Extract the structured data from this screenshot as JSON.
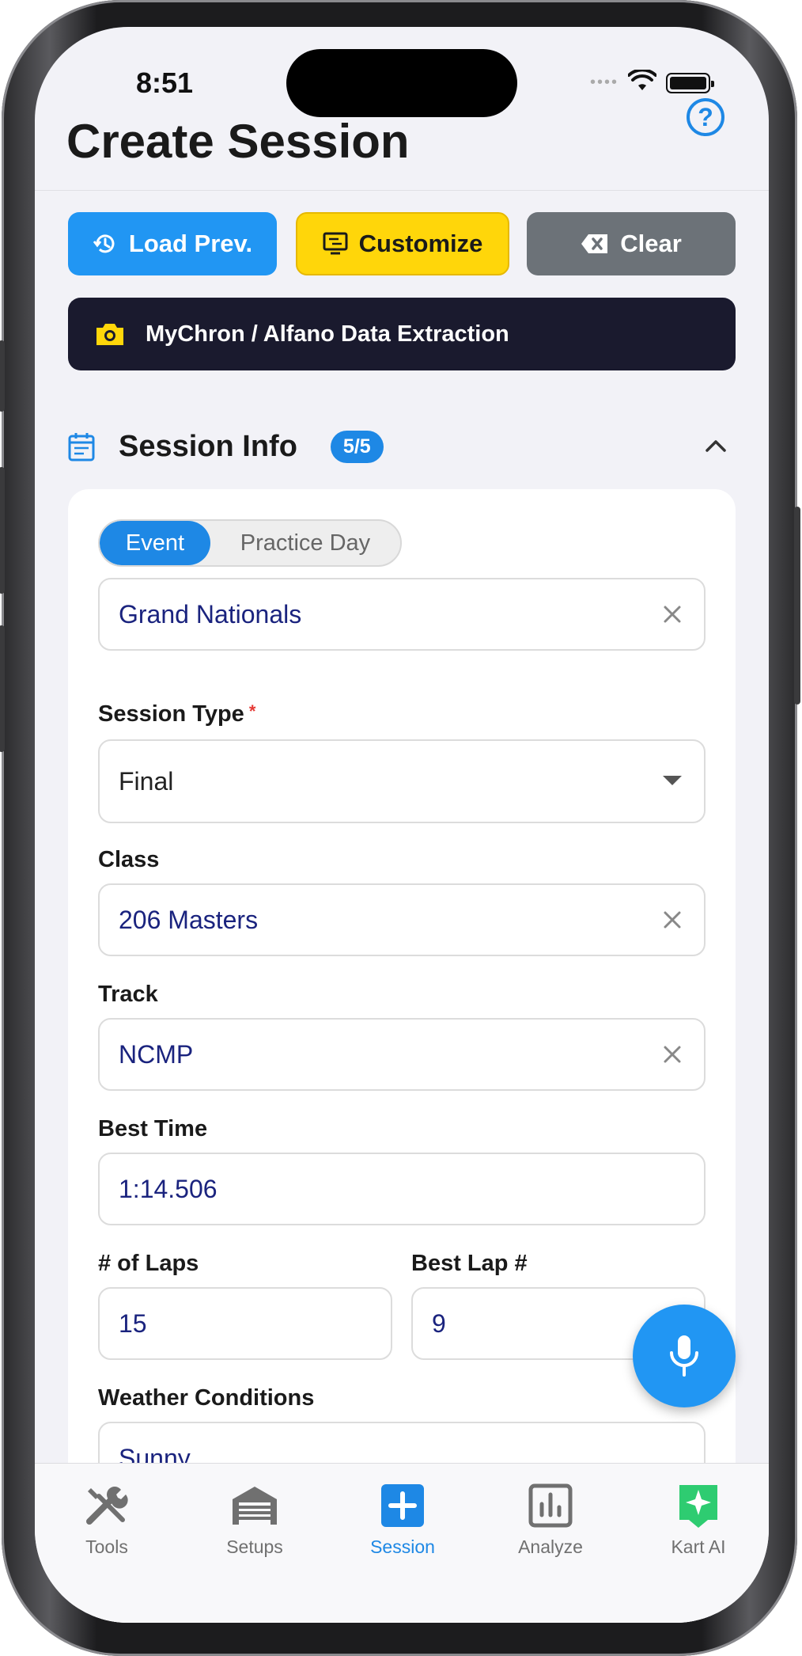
{
  "status_bar": {
    "time": "8:51",
    "signal": "••••"
  },
  "header": {
    "title": "Create Session",
    "help_label": "?"
  },
  "actions": {
    "load_prev": "Load Prev.",
    "customize": "Customize",
    "clear": "Clear",
    "extraction": "MyChron / Alfano Data Extraction"
  },
  "section": {
    "title": "Session Info",
    "badge": "5/5"
  },
  "segment": {
    "option_a": "Event",
    "option_b": "Practice Day",
    "selected": "Event"
  },
  "form": {
    "event_name": "Grand Nationals",
    "session_type_label": "Session Type",
    "session_type_required": "*",
    "session_type_value": "Final",
    "class_label": "Class",
    "class_value": "206 Masters",
    "track_label": "Track",
    "track_value": "NCMP",
    "best_time_label": "Best Time",
    "best_time_value": "1:14.506",
    "laps_label": "# of Laps",
    "laps_value": "15",
    "best_lap_label": "Best Lap #",
    "best_lap_value": "9",
    "weather_label": "Weather Conditions",
    "weather_value": "Sunny"
  },
  "tabbar": {
    "items": [
      {
        "label": "Tools",
        "icon": "tools-icon"
      },
      {
        "label": "Setups",
        "icon": "garage-icon"
      },
      {
        "label": "Session",
        "icon": "plus-square-icon",
        "active": true
      },
      {
        "label": "Analyze",
        "icon": "bar-chart-icon"
      },
      {
        "label": "Kart AI",
        "icon": "sparkle-icon"
      }
    ]
  },
  "colors": {
    "accent": "#2196f3",
    "customize": "#ffd60a",
    "clear": "#6c7278",
    "extraction_bg": "#1a1a2e",
    "kart_ai": "#2ecc71"
  }
}
